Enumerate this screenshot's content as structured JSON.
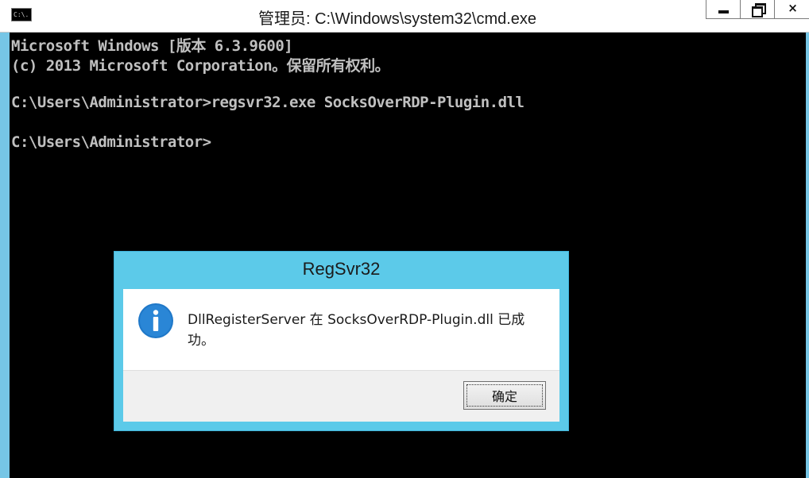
{
  "window": {
    "title": "管理员: C:\\Windows\\system32\\cmd.exe",
    "icon_text": "C:\\.",
    "icon": "cmd-console-icon",
    "controls": {
      "minimize": "minimize-icon",
      "restore": "restore-icon",
      "close": "×"
    }
  },
  "console": {
    "lines": [
      "Microsoft Windows [版本 6.3.9600]",
      "(c) 2013 Microsoft Corporation。保留所有权利。",
      "",
      "C:\\Users\\Administrator>regsvr32.exe SocksOverRDP-Plugin.dll",
      "",
      "C:\\Users\\Administrator>"
    ]
  },
  "dialog": {
    "title": "RegSvr32",
    "icon": "info-icon",
    "message": "DllRegisterServer 在 SocksOverRDP-Plugin.dll 已成功。",
    "ok_label": "确定"
  },
  "colors": {
    "console_bg": "#000000",
    "console_fg": "#c0c0c0",
    "frame_accent": "#5ccae9",
    "info_icon": "#1f78c8"
  }
}
